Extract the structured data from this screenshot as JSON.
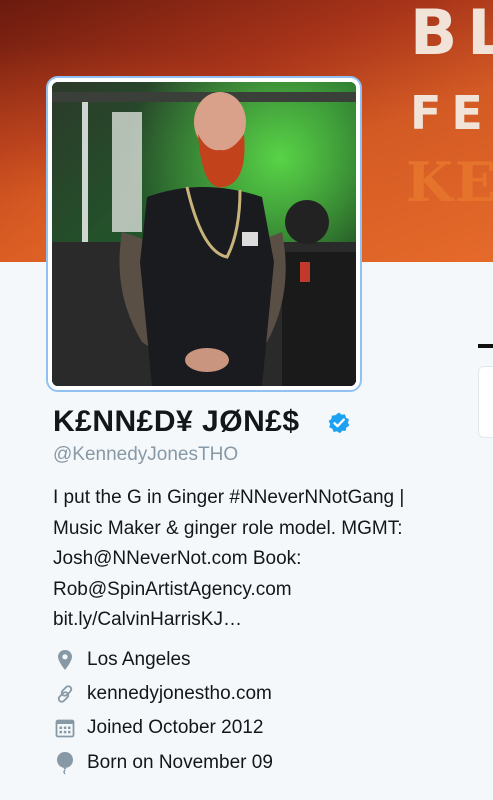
{
  "banner": {
    "line1": "BL",
    "line2": "FEA",
    "line3": "KE"
  },
  "profile": {
    "name": "K£NN£D¥ JØN£$",
    "handle": "@KennedyJonesTHO",
    "verified_icon": "verified-badge-icon",
    "bio_lines": [
      "I put the G in Ginger #NNeverNNotGang |",
      "Music Maker & ginger role model. MGMT:",
      "Josh@NNeverNot.com Book:",
      "Rob@SpinArtistAgency.com",
      "bit.ly/CalvinHarrisKJ…"
    ],
    "location": "Los Angeles",
    "website": "kennedyjonestho.com",
    "joined": "Joined October 2012",
    "born": "Born on November 09"
  },
  "icons": {
    "location": "location-pin-icon",
    "website": "link-icon",
    "joined": "calendar-icon",
    "born": "balloon-icon"
  },
  "colors": {
    "accent": "#1da1f2",
    "muted": "#8899a6",
    "text": "#14171a",
    "background": "#f5f8fa"
  }
}
